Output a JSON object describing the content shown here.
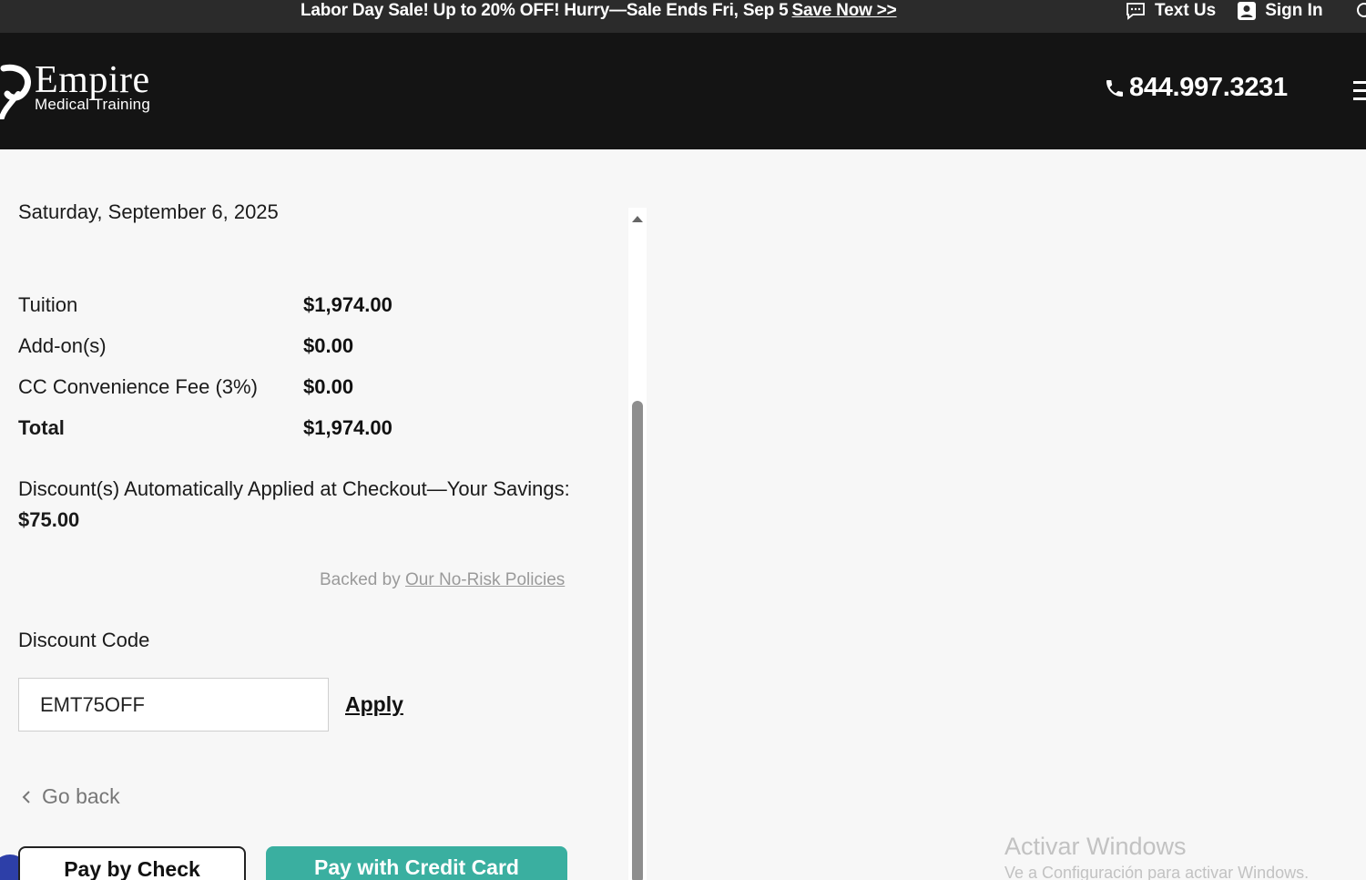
{
  "promo": {
    "text": "Labor Day Sale! Up to 20% OFF! Hurry—Sale Ends Fri, Sep 5",
    "link": "Save Now >>",
    "text_us": "Text Us",
    "sign_in": "Sign In"
  },
  "header": {
    "logo_main": "Empire",
    "logo_sub": "Medical Training",
    "phone": "844.997.3231"
  },
  "summary": {
    "date": "Saturday, September 6, 2025",
    "rows": [
      {
        "label": "Tuition",
        "value": "$1,974.00"
      },
      {
        "label": "Add-on(s)",
        "value": "$0.00"
      },
      {
        "label": "CC Convenience Fee (3%)",
        "value": "$0.00"
      },
      {
        "label": "Total",
        "value": "$1,974.00"
      }
    ],
    "discount_note": "Discount(s) Automatically Applied at Checkout—Your Savings:",
    "discount_amount": "$75.00",
    "backed_prefix": "Backed by",
    "backed_link": "Our No-Risk Policies"
  },
  "discount_form": {
    "label": "Discount Code",
    "value": "EMT75OFF",
    "apply": "Apply"
  },
  "actions": {
    "go_back": "Go back",
    "pay_check": "Pay by Check",
    "pay_card": "Pay with Credit Card"
  },
  "watermark": {
    "title": "Activar Windows",
    "sub": "Ve a Configuración para activar Windows."
  },
  "colors": {
    "accent": "#3aafa0",
    "header_bg": "#141414",
    "promo_bg": "#2b2b2b"
  }
}
